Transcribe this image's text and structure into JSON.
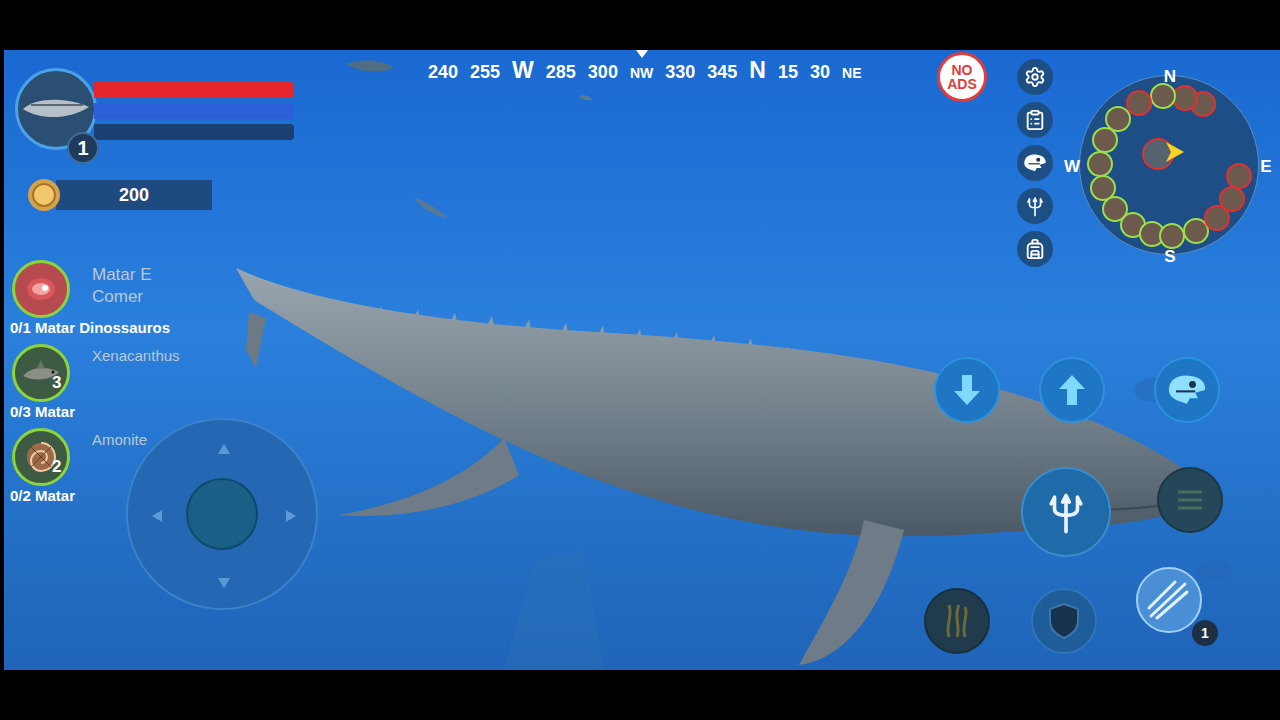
{
  "player": {
    "level": "1",
    "bars": [
      {
        "name": "health",
        "level": 1,
        "color": "#e5262b"
      },
      {
        "name": "energy",
        "level": 1,
        "color": "#2d5fd8"
      },
      {
        "name": "experience",
        "level": 0,
        "color": "#3b82f6"
      }
    ]
  },
  "coins": "200",
  "compass": {
    "marks": [
      {
        "text": "240",
        "kind": "degree"
      },
      {
        "text": "255",
        "kind": "degree"
      },
      {
        "text": "W",
        "kind": "cardinal"
      },
      {
        "text": "285",
        "kind": "degree"
      },
      {
        "text": "300",
        "kind": "degree"
      },
      {
        "text": "NW",
        "kind": "intercardinal"
      },
      {
        "text": "330",
        "kind": "degree"
      },
      {
        "text": "345",
        "kind": "degree"
      },
      {
        "text": "N",
        "kind": "cardinal"
      },
      {
        "text": "15",
        "kind": "degree"
      },
      {
        "text": "30",
        "kind": "degree"
      },
      {
        "text": "NE",
        "kind": "intercardinal"
      }
    ]
  },
  "no_ads": {
    "lines": [
      "NO",
      "ADS"
    ]
  },
  "quests": [
    {
      "title": "Matar E Comer",
      "progress": "0/1 Matar Dinossauros",
      "count": null,
      "kind": "meat"
    },
    {
      "title": "Xenacanthus",
      "progress": "0/3 Matar",
      "count": "3",
      "kind": "shark"
    },
    {
      "title": "Amonite",
      "progress": "0/2 Matar",
      "count": "2",
      "kind": "ammonite"
    }
  ],
  "minimap": {
    "labels": [
      "N",
      "W",
      "E",
      "S"
    ],
    "player": {
      "color": "#e03030"
    },
    "markers": [
      {
        "color": "#e03030"
      },
      {
        "color": "#e03030"
      },
      {
        "color": "#9be04a"
      },
      {
        "color": "#e03030"
      },
      {
        "color": "#9be04a"
      },
      {
        "color": "#9be04a"
      },
      {
        "color": "#9be04a"
      },
      {
        "color": "#9be04a"
      },
      {
        "color": "#9be04a"
      },
      {
        "color": "#9be04a"
      },
      {
        "color": "#9be04a"
      },
      {
        "color": "#9be04a"
      },
      {
        "color": "#9be04a"
      },
      {
        "color": "#e03030"
      },
      {
        "color": "#e03030"
      },
      {
        "color": "#e03030"
      }
    ]
  },
  "skill": {
    "count": "1"
  }
}
